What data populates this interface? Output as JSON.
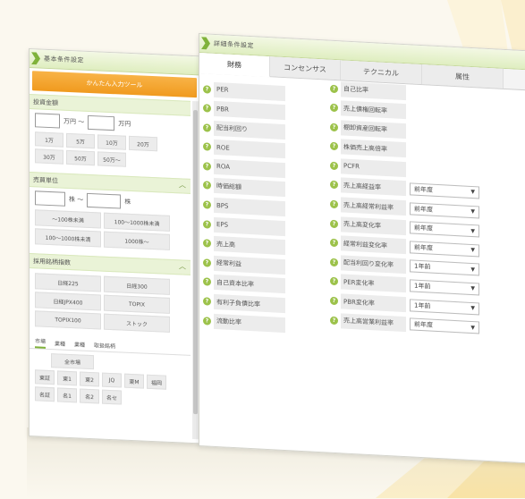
{
  "left_panel": {
    "title": "基本条件設定",
    "orange_button": "かんたん入力ツール",
    "sec_price": {
      "title": "投資金額",
      "unit_from": "万円 ～",
      "unit_to": "万円",
      "chips": [
        "1万",
        "5万",
        "10万",
        "20万",
        "30万",
        "50万",
        "50万～"
      ]
    },
    "sec_volume": {
      "title": "売買単位",
      "unit_from": "株 ～",
      "unit_to": "株",
      "chips": [
        "～100株未満",
        "100～1000株未満",
        "100～1000株未満",
        "1000株～"
      ]
    },
    "sec_index": {
      "title": "採用銘柄指数",
      "chips": [
        "日経225",
        "日経300",
        "日経JPX400",
        "TOPIX",
        "TOPIX100",
        "ストック"
      ]
    },
    "market_tabs": [
      "市場",
      "業種",
      "業種",
      "取扱銘柄"
    ],
    "market_label": "全市場",
    "market_chips": [
      "東証",
      "東1",
      "東2",
      "JQ",
      "東M",
      "福岡",
      "名証",
      "名1",
      "名2",
      "名セ"
    ]
  },
  "right_panel": {
    "title": "詳細条件設定",
    "tabs": [
      "財務",
      "コンセンサス",
      "テクニカル",
      "属性"
    ],
    "left_items": [
      "PER",
      "PBR",
      "配当利回り",
      "ROE",
      "ROA",
      "時価総額",
      "BPS",
      "EPS",
      "売上高",
      "経常利益",
      "自己資本比率",
      "有利子負債比率",
      "流動比率"
    ],
    "right_items": [
      {
        "label": "自己比率",
        "select": null
      },
      {
        "label": "売上債権回転率",
        "select": null
      },
      {
        "label": "棚卸資産回転率",
        "select": null
      },
      {
        "label": "株価売上高倍率",
        "select": null
      },
      {
        "label": "PCFR",
        "select": null
      },
      {
        "label": "売上高経益率",
        "select": "前年度"
      },
      {
        "label": "売上高経常利益率",
        "select": "前年度"
      },
      {
        "label": "売上高変化率",
        "select": "前年度"
      },
      {
        "label": "経常利益変化率",
        "select": "前年度"
      },
      {
        "label": "配当利回り変化率",
        "select": "1年前"
      },
      {
        "label": "PER変化率",
        "select": "1年前"
      },
      {
        "label": "PBR変化率",
        "select": "1年前"
      },
      {
        "label": "売上高営業利益率",
        "select": "前年度"
      }
    ],
    "help_glyph": "?"
  },
  "colors": {
    "accent_green": "#7fb23a",
    "orange": "#f09a1e"
  }
}
